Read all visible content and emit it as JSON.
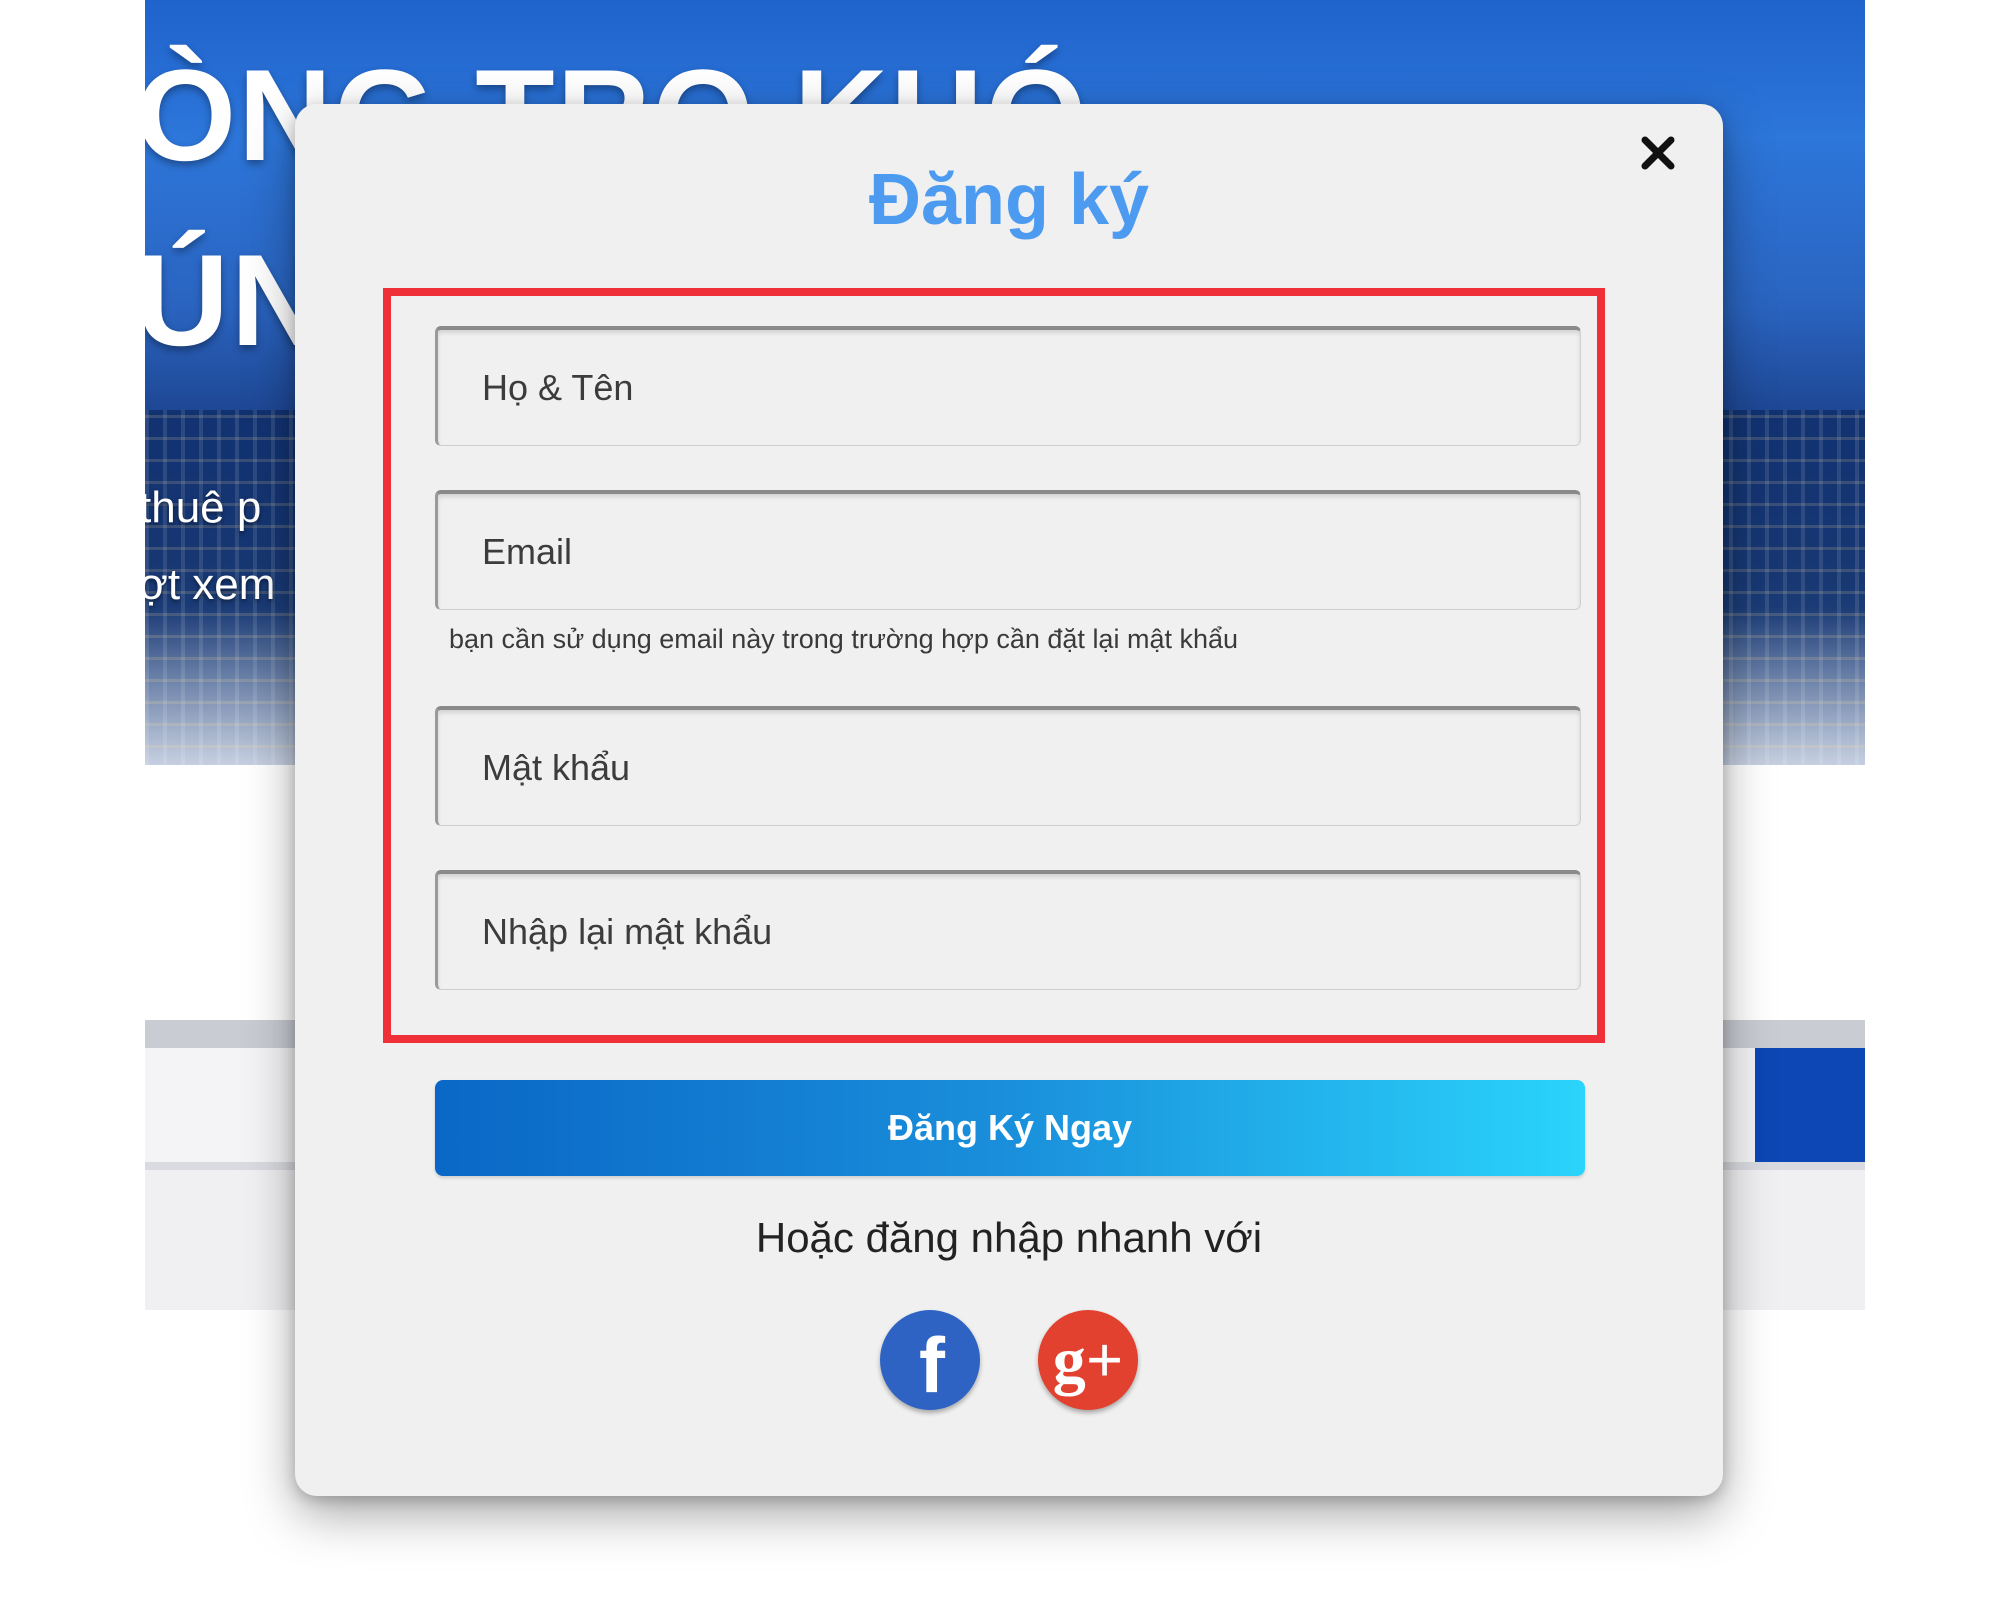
{
  "background": {
    "hero_heading_line1": "ÒNG TRO KHÓ",
    "hero_heading_line2": "ÚNG",
    "hero_sub_line1": "thuê p",
    "hero_sub_line2": "ợt xem"
  },
  "modal": {
    "title": "Đăng ký",
    "close_icon": "close-icon",
    "fields": {
      "full_name_placeholder": "Họ & Tên",
      "email_placeholder": "Email",
      "email_hint": "bạn cần sử dụng email này trong trường hợp cần đặt lại mật khẩu",
      "password_placeholder": "Mật khẩu",
      "confirm_password_placeholder": "Nhập lại mật khẩu"
    },
    "submit_label": "Đăng Ký Ngay",
    "alt_login_text": "Hoặc đăng nhập nhanh với",
    "social": [
      {
        "name": "facebook",
        "icon": "facebook-icon",
        "glyph": "f",
        "color": "#2f63c3"
      },
      {
        "name": "google-plus",
        "icon": "google-plus-icon",
        "glyph": "g+",
        "color": "#e2412f"
      }
    ]
  },
  "colors": {
    "title": "#4d9bf0",
    "highlight_border": "#ef3038",
    "button_gradient_start": "#0a67c6",
    "button_gradient_end": "#2ad4fb"
  }
}
